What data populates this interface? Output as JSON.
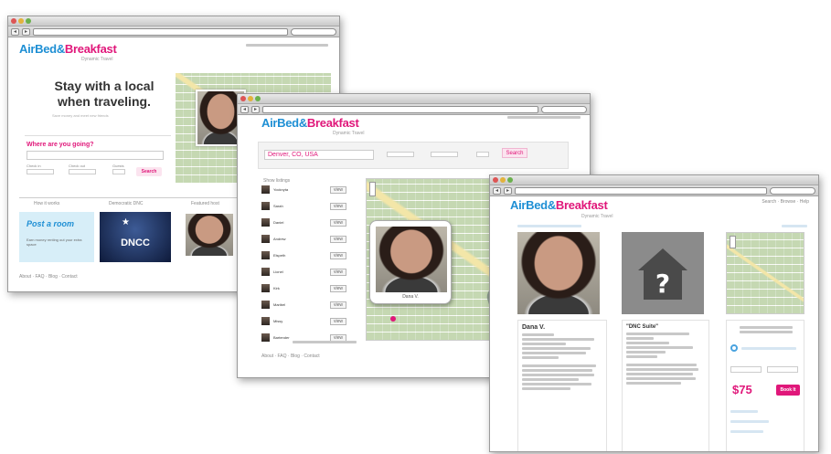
{
  "brand": {
    "air": "AirBed&",
    "breakfast": "Breakfast",
    "tagline": "Dynamic Travel"
  },
  "window1": {
    "hero_title_1": "Stay with a local",
    "hero_title_2": "when traveling.",
    "hero_sub": "Save money and meet new friends",
    "search_prompt": "Where are you going?",
    "search_button": "Search",
    "checkin_label": "Check in",
    "checkout_label": "Check out",
    "guests_label": "Guests",
    "col1": "How it works",
    "col2": "Democratic DNC",
    "col3": "Featured host",
    "post_room": "Post a room",
    "post_room_sub": "Earn money renting out your extra space",
    "dncc": "DNCC",
    "footer": "About · FAQ · Blog · Contact"
  },
  "window2": {
    "location_value": "Denver, CO, USA",
    "search_button": "Search",
    "results_header": "Show listings",
    "listings": [
      "Yocknyta",
      "Sarah",
      "Daniel",
      "Andrew",
      "Elspeth",
      "Lionel",
      "Kirk",
      "Maribel",
      "Missy",
      "Bartender"
    ],
    "listing_button": "view",
    "popup_caption": "Dana V.",
    "footer": "About · FAQ · Blog · Contact"
  },
  "window3": {
    "host_name": "Dana V.",
    "listing_title": "\"DNC Suite\"",
    "price": "$75",
    "book_button": "Book It",
    "nav_links": "Search · Browse · Help"
  },
  "colors": {
    "air_blue": "#1e8fd4",
    "bb_pink": "#e0177a"
  }
}
